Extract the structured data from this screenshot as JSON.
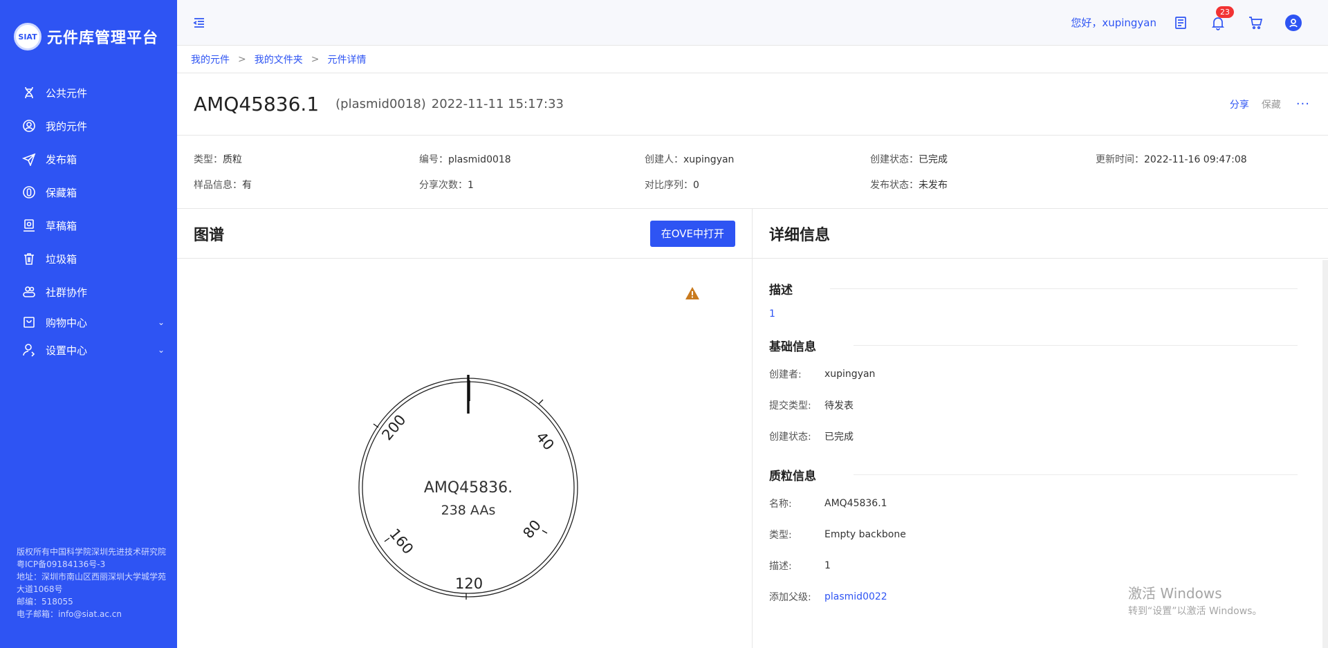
{
  "sidebar": {
    "logo_text": "SIAT",
    "brand": "元件库管理平台",
    "items": [
      {
        "label": "公共元件"
      },
      {
        "label": "我的元件"
      },
      {
        "label": "发布箱"
      },
      {
        "label": "保藏箱"
      },
      {
        "label": "草稿箱"
      },
      {
        "label": "垃圾箱"
      },
      {
        "label": "社群协作"
      },
      {
        "label": "购物中心"
      },
      {
        "label": "设置中心"
      }
    ],
    "footer": {
      "line1": "版权所有中国科学院深圳先进技术研究院 粤ICP备09184136号-3",
      "line2": "地址：深圳市南山区西丽深圳大学城学苑大道1068号",
      "line3": "邮编：518055",
      "line4": "电子邮箱：info@siat.ac.cn"
    }
  },
  "header": {
    "greeting": "您好，xupingyan",
    "notification_count": "23"
  },
  "breadcrumb": [
    "我的元件",
    "我的文件夹",
    "元件详情"
  ],
  "titlebar": {
    "name": "AMQ45836.1",
    "code": "(plasmid0018)",
    "time": "2022-11-11 15:17:33",
    "share": "分享",
    "save": "保藏",
    "more": "···"
  },
  "meta": {
    "row1": [
      {
        "k": "类型：",
        "v": "质粒"
      },
      {
        "k": "编号：",
        "v": "plasmid0018"
      },
      {
        "k": "创建人：",
        "v": "xupingyan"
      },
      {
        "k": "创建状态：",
        "v": "已完成"
      },
      {
        "k": "更新时间：",
        "v": "2022-11-16 09:47:08"
      }
    ],
    "row2": [
      {
        "k": "样品信息：",
        "v": "有"
      },
      {
        "k": "分享次数：",
        "v": "1"
      },
      {
        "k": "对比序列：",
        "v": "0"
      },
      {
        "k": "发布状态：",
        "v": "未发布"
      }
    ]
  },
  "map_panel": {
    "title": "图谱",
    "open_button": "在OVE中打开",
    "plasmid_name": "AMQ45836.",
    "length": "238 AAs",
    "ticks": [
      "40",
      "80",
      "120",
      "160",
      "200"
    ]
  },
  "detail_panel": {
    "title": "详细信息",
    "desc_title": "描述",
    "desc_value": "1",
    "basic_title": "基础信息",
    "basic": [
      {
        "k": "创建者:",
        "v": "xupingyan"
      },
      {
        "k": "提交类型:",
        "v": "待发表"
      },
      {
        "k": "创建状态:",
        "v": "已完成"
      }
    ],
    "plasmid_title": "质粒信息",
    "plasmid": [
      {
        "k": "名称:",
        "v": "AMQ45836.1"
      },
      {
        "k": "类型:",
        "v": "Empty backbone"
      },
      {
        "k": "描述:",
        "v": "1"
      },
      {
        "k": "添加父级:",
        "v": "plasmid0022"
      }
    ]
  },
  "watermark": {
    "line1": "激活 Windows",
    "line2": "转到“设置”以激活 Windows。"
  }
}
